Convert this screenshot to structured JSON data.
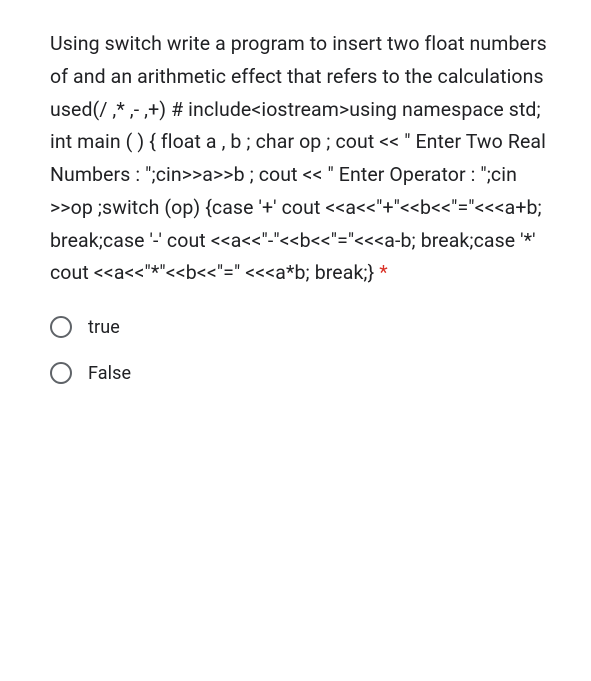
{
  "question": {
    "text": "Using switch write a program to insert two float numbers of and an arithmetic effect that refers to the calculations used(/ ,* ,- ,+) # include<iostream>using namespace std; int main ( ) { float a , b ; char op ; cout << \" Enter Two Real Numbers : \";cin>>a>>b ; cout << \" Enter Operator : \";cin >>op ;switch (op) {case '+' cout <<a<<\"+\"<<b<<\"=\"<<<a+b; break;case '-' cout <<a<<\"-\"<<b<<\"=\"<<<a-b; break;case '*' cout <<a<<\"*\"<<b<<\"=\" <<<a*b; break;}",
    "required_marker": "*"
  },
  "options": [
    {
      "label": "true"
    },
    {
      "label": "False"
    }
  ]
}
